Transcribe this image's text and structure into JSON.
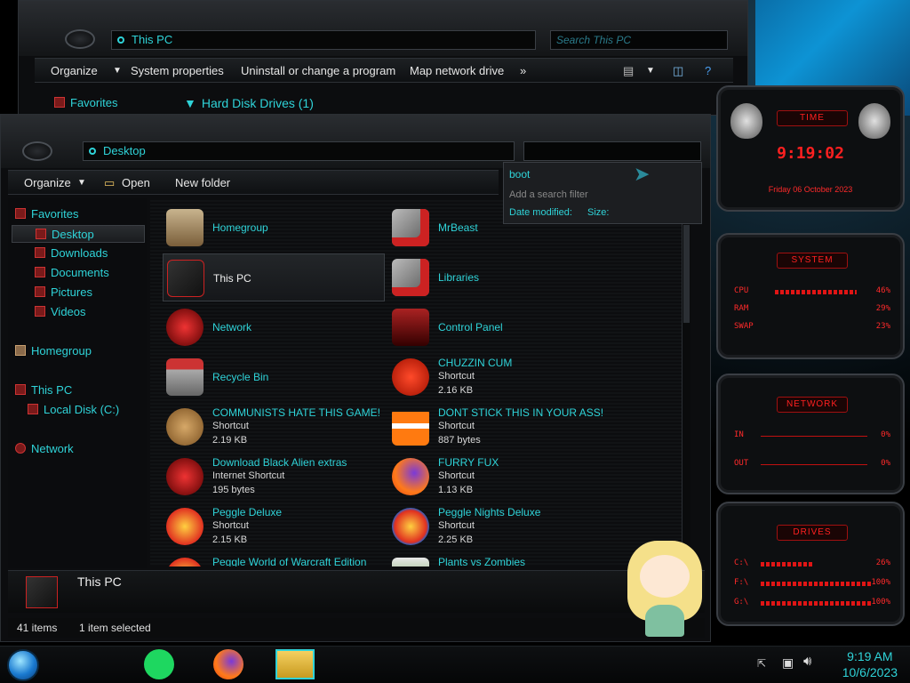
{
  "back_window": {
    "address": "This PC",
    "search_placeholder": "Search This PC",
    "commands": [
      "Organize",
      "System properties",
      "Uninstall or change a program",
      "Map network drive",
      "»"
    ],
    "nav_favorites": "Favorites",
    "group_header": "Hard Disk Drives (1)"
  },
  "front_window": {
    "address": "Desktop",
    "commands": {
      "organize": "Organize",
      "open": "Open",
      "new_folder": "New folder"
    },
    "nav": {
      "favorites": "Favorites",
      "desktop": "Desktop",
      "downloads": "Downloads",
      "documents": "Documents",
      "pictures": "Pictures",
      "videos": "Videos",
      "homegroup": "Homegroup",
      "this_pc": "This PC",
      "local_disk": "Local Disk (C:)",
      "network": "Network"
    },
    "items": [
      {
        "name": "Homegroup"
      },
      {
        "name": "MrBeast"
      },
      {
        "name": "This PC"
      },
      {
        "name": "Libraries"
      },
      {
        "name": "Network"
      },
      {
        "name": "Control Panel"
      },
      {
        "name": "Recycle Bin"
      },
      {
        "name": "CHUZZIN CUM",
        "type": "Shortcut",
        "size": "2.16 KB"
      },
      {
        "name": "COMMUNISTS HATE THIS GAME!",
        "type": "Shortcut",
        "size": "2.19 KB"
      },
      {
        "name": "DONT STICK THIS IN YOUR ASS!",
        "type": "Shortcut",
        "size": "887 bytes"
      },
      {
        "name": "Download Black Alien extras",
        "type": "Internet Shortcut",
        "size": "195 bytes"
      },
      {
        "name": "FURRY FUX",
        "type": "Shortcut",
        "size": "1.13 KB"
      },
      {
        "name": "Peggle Deluxe",
        "type": "Shortcut",
        "size": "2.15 KB"
      },
      {
        "name": "Peggle Nights Deluxe",
        "type": "Shortcut",
        "size": "2.25 KB"
      },
      {
        "name": "Peggle World of Warcraft Edition"
      },
      {
        "name": "Plants vs Zombies"
      }
    ],
    "details_title": "This PC",
    "status": {
      "count": "41 items",
      "selected": "1 item selected"
    }
  },
  "search_dropdown": {
    "query": "boot",
    "hint": "Add a search filter",
    "filters": [
      "Date modified:",
      "Size:"
    ]
  },
  "gadgets": {
    "time": {
      "title": "TIME",
      "clock": "9:19:02",
      "date": "Friday 06 October 2023"
    },
    "system": {
      "title": "SYSTEM",
      "rows": [
        {
          "label": "CPU",
          "value": "46%",
          "level": 0.46
        },
        {
          "label": "RAM",
          "value": "29%",
          "level": 0.29
        },
        {
          "label": "SWAP",
          "value": "23%",
          "level": 0.23
        }
      ]
    },
    "network": {
      "title": "NETWORK",
      "rows": [
        {
          "label": "IN",
          "value": "0%"
        },
        {
          "label": "OUT",
          "value": "0%"
        }
      ]
    },
    "drives": {
      "title": "DRIVES",
      "rows": [
        {
          "label": "C:\\",
          "value": "26%",
          "level": 0.26
        },
        {
          "label": "F:\\",
          "value": "100%",
          "level": 1.0
        },
        {
          "label": "G:\\",
          "value": "100%",
          "level": 1.0
        }
      ]
    }
  },
  "taskbar": {
    "time": "9:19 AM",
    "date": "10/6/2023"
  },
  "colors": {
    "accent": "#2fd3d8",
    "gadget_red": "#ff2020",
    "background": "#0c0d0f"
  }
}
